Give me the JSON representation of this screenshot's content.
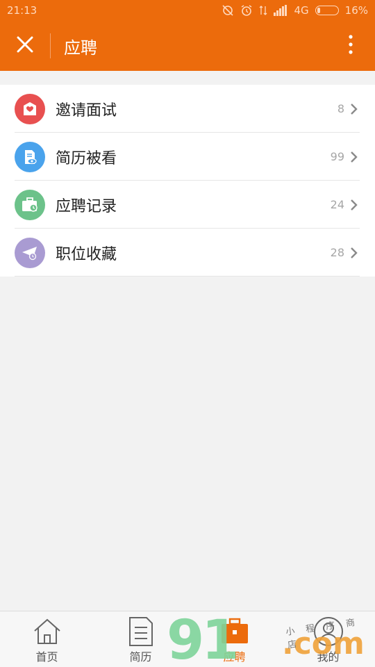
{
  "status_bar": {
    "time": "21:13",
    "network": "4G",
    "battery": "16%"
  },
  "header": {
    "title": "应聘",
    "close_icon": "close-icon",
    "more_icon": "more-vertical-icon",
    "color": "#ec6b0c"
  },
  "list": {
    "items": [
      {
        "label": "邀请面试",
        "count": "8",
        "icon": "envelope-heart-icon",
        "color": "#e85050"
      },
      {
        "label": "简历被看",
        "count": "99",
        "icon": "resume-eye-icon",
        "color": "#4aa3ec"
      },
      {
        "label": "应聘记录",
        "count": "24",
        "icon": "briefcase-clock-icon",
        "color": "#6cc28a"
      },
      {
        "label": "职位收藏",
        "count": "28",
        "icon": "paper-plane-clock-icon",
        "color": "#a99bd2"
      }
    ]
  },
  "bottom_nav": {
    "items": [
      {
        "label": "首页",
        "icon": "home-icon"
      },
      {
        "label": "简历",
        "icon": "document-icon"
      },
      {
        "label": "应聘",
        "icon": "briefcase-icon",
        "active": true
      },
      {
        "label": "我的",
        "icon": "user-icon"
      }
    ]
  },
  "watermark": {
    "brand": "91",
    "domain": ".com",
    "shop": "小 程 序 商 店"
  }
}
